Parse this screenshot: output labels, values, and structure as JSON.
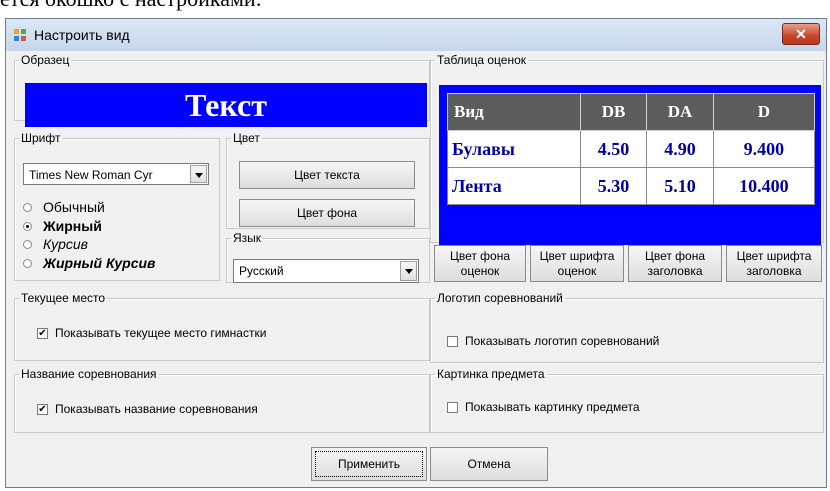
{
  "doc_fragment": "ется окошко с настройками:",
  "window": {
    "title": "Настроить вид",
    "close_glyph": "✕"
  },
  "sample": {
    "legend": "Образец",
    "text": "Текст",
    "background": "#0000ff"
  },
  "font_group": {
    "legend": "Шрифт",
    "selected_font": "Times New Roman Cyr",
    "styles": [
      {
        "label": "Обычный",
        "selected": false
      },
      {
        "label": "Жирный",
        "selected": true
      },
      {
        "label": "Курсив",
        "selected": false
      },
      {
        "label": "Жирный Курсив",
        "selected": false
      }
    ]
  },
  "color_group": {
    "legend": "Цвет",
    "text_color_button": "Цвет текста",
    "bg_color_button": "Цвет фона"
  },
  "language_group": {
    "legend": "Язык",
    "selected": "Русский"
  },
  "scores_table": {
    "legend": "Таблица оценок",
    "headers": [
      "Вид",
      "DB",
      "DA",
      "D"
    ],
    "rows": [
      [
        "Булавы",
        "4.50",
        "4.90",
        "9.400"
      ],
      [
        "Лента",
        "5.30",
        "5.10",
        "10.400"
      ]
    ],
    "buttons": [
      "Цвет фона\nоценок",
      "Цвет шрифта\nоценок",
      "Цвет фона\nзаголовка",
      "Цвет шрифта\nзаголовка"
    ]
  },
  "current_place": {
    "legend": "Текущее место",
    "checkbox_label": "Показывать текущее место гимнастки",
    "checked": true
  },
  "competition_logo": {
    "legend": "Логотип соревнований",
    "checkbox_label": "Показывать логотип соревнований",
    "checked": false
  },
  "competition_name": {
    "legend": "Название соревнования",
    "checkbox_label": "Показывать название соревнования",
    "checked": true
  },
  "subject_picture": {
    "legend": "Картинка предмета",
    "checkbox_label": "Показывать картинку предмета",
    "checked": false
  },
  "footer": {
    "apply_button": "Применить",
    "cancel_button": "Отмена"
  },
  "check_glyph": "✔"
}
